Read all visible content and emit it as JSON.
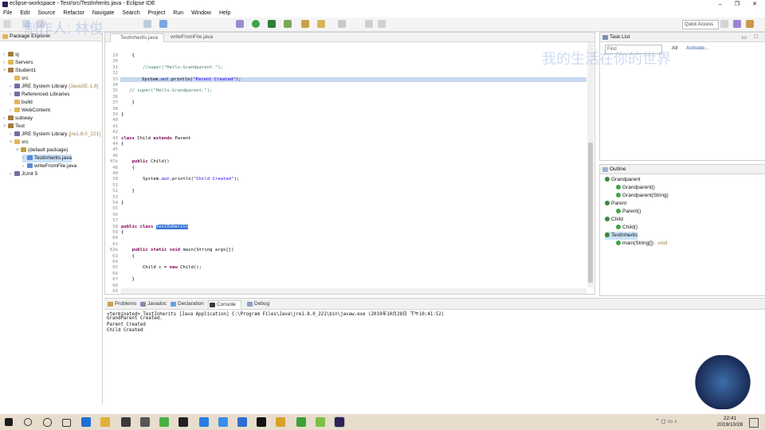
{
  "window": {
    "title": "eclipse-workspace - Test/src/TestInherits.java - Eclipse IDE",
    "minimize": "–",
    "maximize": "❐",
    "close": "✕"
  },
  "menu": [
    "File",
    "Edit",
    "Source",
    "Refactor",
    "Navigate",
    "Search",
    "Project",
    "Run",
    "Window",
    "Help"
  ],
  "toolbar": {
    "quick_access": "Quick Access"
  },
  "explorer": {
    "tab_label": "Package Explorer",
    "items": [
      {
        "label": "sj",
        "indent": 0,
        "twisty": "›",
        "kind": "proj"
      },
      {
        "label": "Servers",
        "indent": 0,
        "twisty": "›",
        "kind": "folder"
      },
      {
        "label": "Student1",
        "indent": 0,
        "twisty": "˅",
        "kind": "proj"
      },
      {
        "label": "src",
        "indent": 1,
        "twisty": "",
        "kind": "folder"
      },
      {
        "label": "JRE System Library",
        "suffix": "[JavaSE-1.8]",
        "indent": 1,
        "twisty": "›",
        "kind": "lib"
      },
      {
        "label": "Referenced Libraries",
        "indent": 1,
        "twisty": "›",
        "kind": "lib"
      },
      {
        "label": "build",
        "indent": 1,
        "twisty": "",
        "kind": "folder"
      },
      {
        "label": "WebContent",
        "indent": 1,
        "twisty": "›",
        "kind": "folder"
      },
      {
        "label": "subway",
        "indent": 0,
        "twisty": "›",
        "kind": "proj"
      },
      {
        "label": "Test",
        "indent": 0,
        "twisty": "˅",
        "kind": "proj"
      },
      {
        "label": "JRE System Library",
        "suffix": "[jre1.8.0_221]",
        "indent": 1,
        "twisty": "›",
        "kind": "lib"
      },
      {
        "label": "src",
        "indent": 1,
        "twisty": "˅",
        "kind": "folder"
      },
      {
        "label": "(default package)",
        "indent": 2,
        "twisty": "˅",
        "kind": "pkg"
      },
      {
        "label": "TestInherits.java",
        "indent": 3,
        "twisty": "›",
        "kind": "java",
        "selected": true
      },
      {
        "label": "writeFromFile.java",
        "indent": 3,
        "twisty": "›",
        "kind": "java"
      },
      {
        "label": "JUnit 5",
        "indent": 1,
        "twisty": "›",
        "kind": "lib"
      }
    ]
  },
  "editor": {
    "tabs": [
      "TestInherits.java",
      "writeFromFile.java"
    ],
    "lines": [
      {
        "n": "29",
        "html": "    {"
      },
      {
        "n": "30",
        "html": ""
      },
      {
        "n": "31",
        "html": "        <span class='cmt'>//super(\"Hello.Grandparent.\");</span>"
      },
      {
        "n": "32",
        "html": ""
      },
      {
        "n": "33",
        "html": "        System.<span class='fld'>out</span>.println(<span class='str'>\"Parent Created\"</span>);",
        "hl": true
      },
      {
        "n": "34",
        "html": ""
      },
      {
        "n": "35",
        "html": "   <span class='cmt'>// super(\"Hello.Grandparent.\");</span>"
      },
      {
        "n": "36",
        "html": ""
      },
      {
        "n": "37",
        "html": "    }"
      },
      {
        "n": "38",
        "html": ""
      },
      {
        "n": "39",
        "html": "}"
      },
      {
        "n": "40",
        "html": ""
      },
      {
        "n": "41",
        "html": ""
      },
      {
        "n": "42",
        "html": ""
      },
      {
        "n": "43",
        "html": "<span class='kw'>class</span> Child <span class='kw'>extends</span> Parent"
      },
      {
        "n": "44",
        "html": "{"
      },
      {
        "n": "45",
        "html": ""
      },
      {
        "n": "46",
        "html": ""
      },
      {
        "n": "47⊖",
        "html": "    <span class='kw'>public</span> Child()"
      },
      {
        "n": "48",
        "html": "    {"
      },
      {
        "n": "49",
        "html": ""
      },
      {
        "n": "50",
        "html": "        System.<span class='fld'>out</span>.println(<span class='str'>\"Child Created\"</span>);"
      },
      {
        "n": "51",
        "html": ""
      },
      {
        "n": "52",
        "html": "    }"
      },
      {
        "n": "53",
        "html": ""
      },
      {
        "n": "54",
        "html": "}"
      },
      {
        "n": "55",
        "html": ""
      },
      {
        "n": "56",
        "html": ""
      },
      {
        "n": "57",
        "html": ""
      },
      {
        "n": "58",
        "html": "<span class='kw'>public class</span> <span class='selt'>TestInherits</span>"
      },
      {
        "n": "59",
        "html": "{"
      },
      {
        "n": "60",
        "html": ""
      },
      {
        "n": "61",
        "html": ""
      },
      {
        "n": "62⊖",
        "html": "    <span class='kw'>public static void</span> main(String args[])"
      },
      {
        "n": "63",
        "html": "    {"
      },
      {
        "n": "64",
        "html": ""
      },
      {
        "n": "65",
        "html": "        Child c = <span class='kw'>new</span> Child();"
      },
      {
        "n": "66",
        "html": ""
      },
      {
        "n": "67",
        "html": "    }"
      },
      {
        "n": "68",
        "html": ""
      },
      {
        "n": "69",
        "html": "}"
      }
    ]
  },
  "tasklist": {
    "title": "Task List",
    "find_placeholder": "Find",
    "all_label": "All",
    "activate_label": "Activate..."
  },
  "outline": {
    "title": "Outline",
    "items": [
      {
        "label": "Grandparent",
        "indent": 0,
        "kind": "class"
      },
      {
        "label": "Grandparent()",
        "indent": 1,
        "kind": "ctor"
      },
      {
        "label": "Grandparent(String)",
        "indent": 1,
        "kind": "ctor"
      },
      {
        "label": "Parent",
        "indent": 0,
        "kind": "class"
      },
      {
        "label": "Parent()",
        "indent": 1,
        "kind": "ctor"
      },
      {
        "label": "Child",
        "indent": 0,
        "kind": "class"
      },
      {
        "label": "Child()",
        "indent": 1,
        "kind": "ctor"
      },
      {
        "label": "TestInherits",
        "indent": 0,
        "kind": "class",
        "selected": true
      },
      {
        "label": "main(String[])",
        "suffix": ": void",
        "indent": 1,
        "kind": "method"
      }
    ]
  },
  "console": {
    "tabs": [
      "Problems",
      "Javadoc",
      "Declaration",
      "Console",
      "Debug"
    ],
    "header": "<terminated> TestInherits [Java Application] C:\\Program Files\\Java\\jre1.8.0_221\\bin\\javaw.exe (2019年10月28日 下午10:41:52)",
    "output": [
      "GrandParent Created.",
      "Parent Created",
      "Child Created"
    ]
  },
  "taskbar": {
    "time": "22:41",
    "date": "2019/10/28"
  },
  "watermarks": [
    "制作人: 林俊",
    "我的生活在你的世界"
  ]
}
